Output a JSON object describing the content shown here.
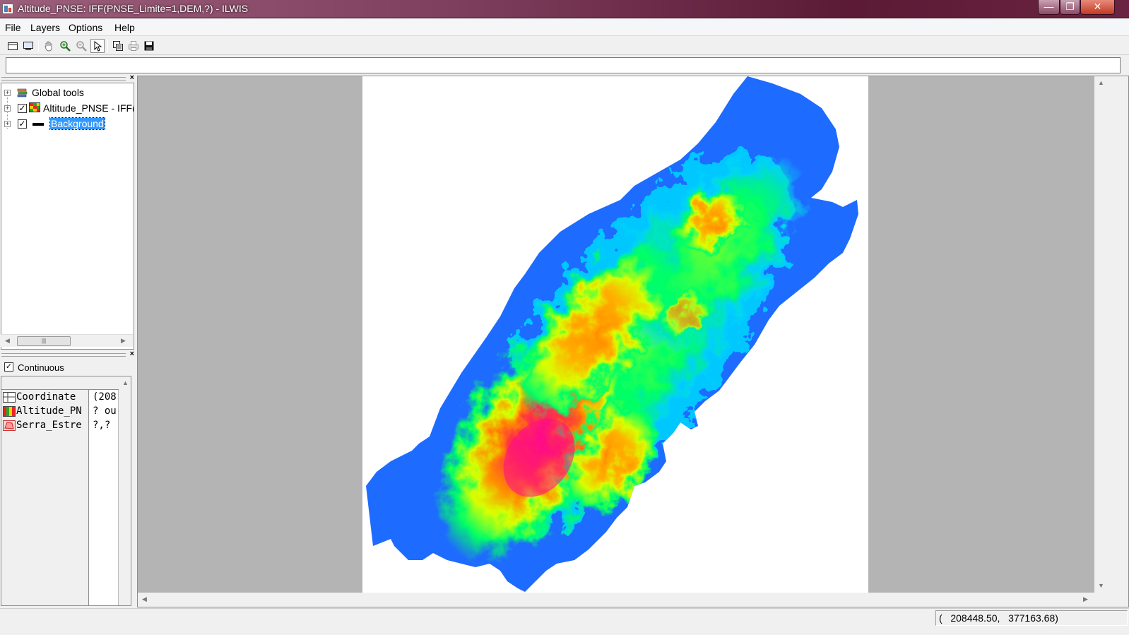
{
  "window": {
    "title": "Altitude_PNSE: IFF(PNSE_Limite=1,DEM,?) - ILWIS",
    "minimize": "—",
    "maximize": "❐",
    "close": "✕"
  },
  "menu": [
    {
      "label": "File"
    },
    {
      "label": "Layers"
    },
    {
      "label": "Options"
    },
    {
      "label": "Help"
    }
  ],
  "toolbar": {
    "tools": [
      "entire-map-icon",
      "normal-view-icon",
      "pan-icon",
      "zoom-in-icon",
      "zoom-out-icon",
      "select-pointer-icon",
      "copy-icon",
      "print-icon",
      "save-icon"
    ],
    "selected_tool": "select-pointer-icon"
  },
  "command_line": {
    "value": ""
  },
  "layer_tree": {
    "close": "×",
    "items": [
      {
        "label": "Global tools",
        "checked": null,
        "icon": "global-tools-icon"
      },
      {
        "label": "Altitude_PNSE - IFF(",
        "checked": true,
        "icon": "raster-map-icon"
      },
      {
        "label": "Background",
        "checked": true,
        "icon": "background-icon",
        "selected": true
      }
    ]
  },
  "legend": {
    "close": "×",
    "continuous_label": "Continuous",
    "continuous_checked": true
  },
  "pixel_info": {
    "rows": [
      {
        "name": "Coordinate",
        "value": "(208",
        "icon": "coordinate-icon"
      },
      {
        "name": "Altitude_PN",
        "value": "? ou",
        "icon": "raster-icon"
      },
      {
        "name": "Serra_Estre",
        "value": "?,?",
        "icon": "polygon-icon"
      }
    ]
  },
  "map": {
    "color_ramp": [
      "#1e6bff",
      "#00e0ff",
      "#00ff66",
      "#d8ff00",
      "#ff8c00",
      "#ff0a8c"
    ]
  },
  "status": {
    "coordinates": "(   208448.50,   377163.68)"
  }
}
